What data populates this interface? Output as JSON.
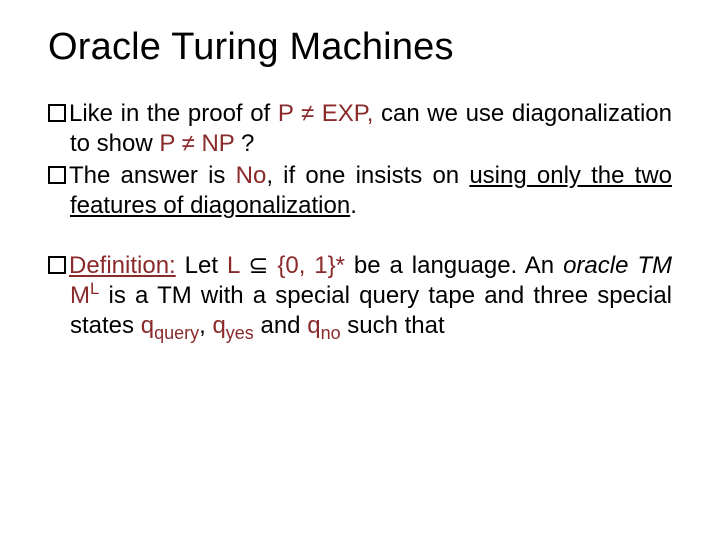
{
  "title": "Oracle Turing Machines",
  "bullets": {
    "b1": {
      "lead": "Like",
      "t1": " in the proof of ",
      "pexp": "P ≠ EXP,",
      "t2": " can we use diagonalization to show ",
      "pnp": "P ≠ NP",
      "t3": " ?"
    },
    "b2": {
      "lead": "The",
      "t1": " answer is ",
      "no": "No",
      "t2": ", if one insists on ",
      "u1": "using only the two features of diagonalization",
      "t3": "."
    },
    "b3": {
      "def": "Definition:",
      "t1": " Let ",
      "L": "L",
      "sub1": " ⊆ ",
      "set": "{0, 1}*",
      "t2": " be a language. An ",
      "oracle": "oracle TM",
      "m": " M",
      "mexp": "L",
      "t3": " is a TM with a special query tape and three special states ",
      "q": "q",
      "qsub1": "query",
      "sep1": ", ",
      "qsub2": "yes",
      "sep2": " and ",
      "qsub3": "no",
      "t4": " such that"
    }
  }
}
